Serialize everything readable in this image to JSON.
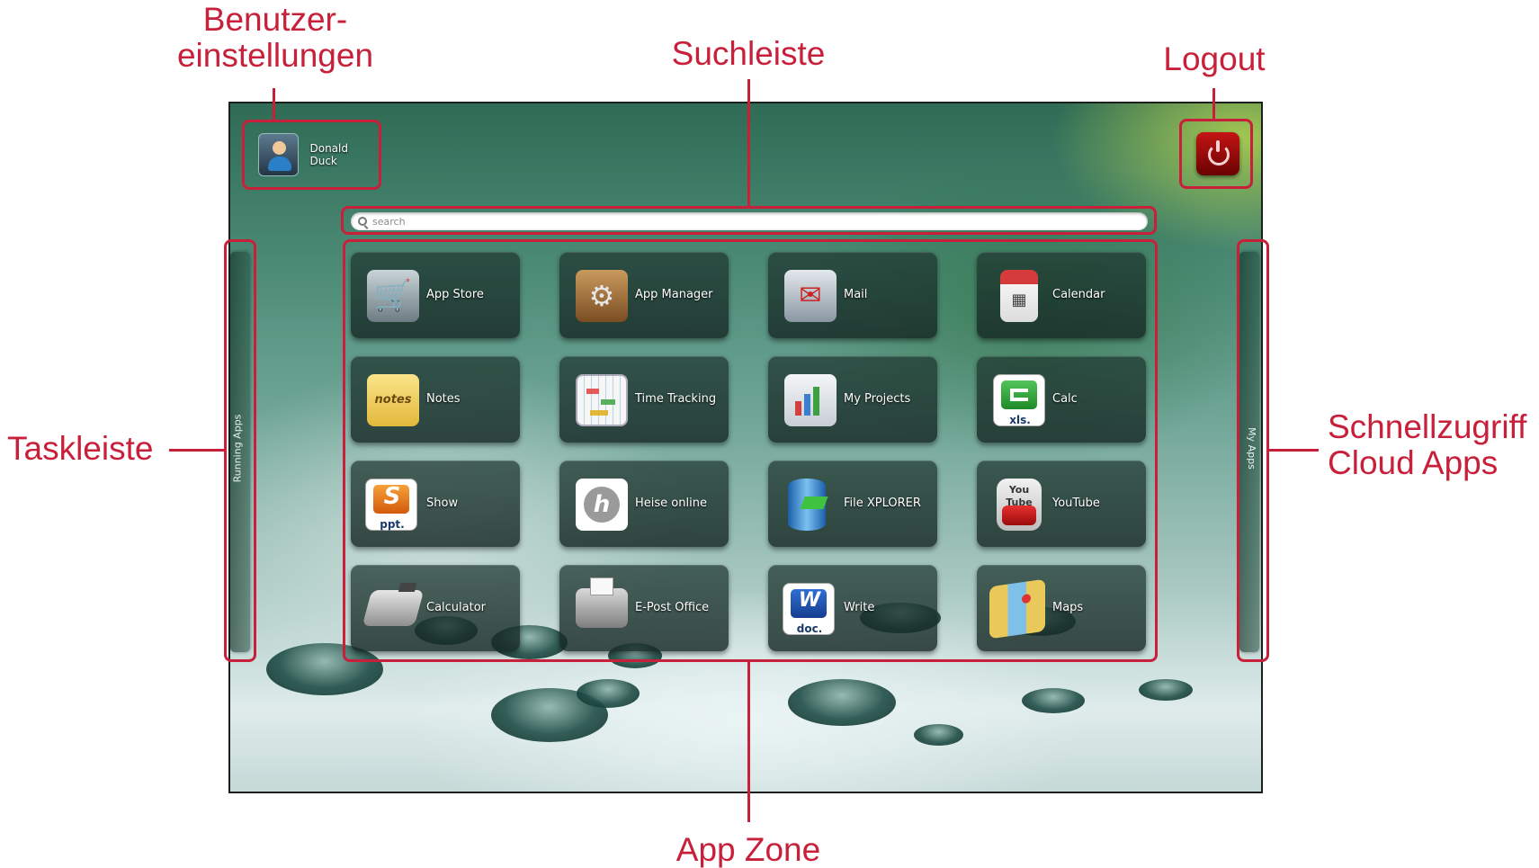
{
  "callouts": {
    "user_settings": "Benutzer-\neinstellungen",
    "search_bar": "Suchleiste",
    "logout": "Logout",
    "taskbar": "Taskleiste",
    "quick_access": "Schnellzugriff\nCloud Apps",
    "app_zone": "App Zone"
  },
  "user": {
    "name": "Donald Duck"
  },
  "search": {
    "placeholder": "search"
  },
  "side_panels": {
    "left_label": "Running Apps",
    "right_label": "My Apps"
  },
  "apps": [
    {
      "label": "App Store",
      "icon": "cart-icon"
    },
    {
      "label": "App Manager",
      "icon": "box-gear-icon"
    },
    {
      "label": "Mail",
      "icon": "mailbox-icon"
    },
    {
      "label": "Calendar",
      "icon": "calendar-icon"
    },
    {
      "label": "Notes",
      "icon": "notes-icon"
    },
    {
      "label": "Time Tracking",
      "icon": "timesheet-icon"
    },
    {
      "label": "My Projects",
      "icon": "presentation-icon"
    },
    {
      "label": "Calc",
      "icon": "xls-icon"
    },
    {
      "label": "Show",
      "icon": "ppt-icon"
    },
    {
      "label": "Heise online",
      "icon": "heise-icon"
    },
    {
      "label": "File XPLORER",
      "icon": "file-drum-icon"
    },
    {
      "label": "YouTube",
      "icon": "youtube-icon"
    },
    {
      "label": "Calculator",
      "icon": "cash-register-icon"
    },
    {
      "label": "E-Post Office",
      "icon": "fax-icon"
    },
    {
      "label": "Write",
      "icon": "doc-icon"
    },
    {
      "label": "Maps",
      "icon": "map-icon"
    }
  ],
  "icon_texts": {
    "calc": "xls.",
    "show": "ppt.",
    "write": "doc.",
    "notes": "notes",
    "youtube": "You Tube"
  },
  "colors": {
    "annotation": "#c8203a",
    "logout_button": "#b01010",
    "tile_bg": "#1e3730"
  }
}
